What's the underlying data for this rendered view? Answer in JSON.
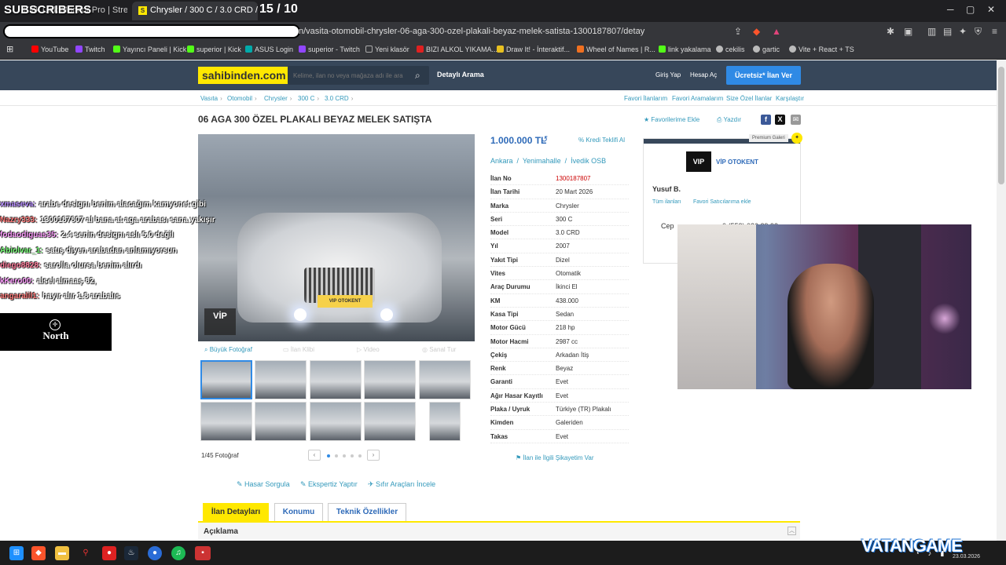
{
  "browser": {
    "tabs": [
      {
        "label": "Kick Link Monitor Pro | Stream Deck"
      },
      {
        "label": "Chrysler / 300 C / 3.0 CRD / 06 A..."
      }
    ],
    "new_tab": "+",
    "url": "n/vasita-otomobil-chrysler-06-aga-300-ozel-plakali-beyaz-melek-satista-1300187807/detay",
    "bookmarks": [
      {
        "label": "YouTube",
        "color": "#ff0000"
      },
      {
        "label": "Twitch",
        "color": "#9146ff"
      },
      {
        "label": "Yayıncı Paneli | Kick",
        "color": "#53fc18"
      },
      {
        "label": "superior | Kick",
        "color": "#53fc18"
      },
      {
        "label": "ASUS Login",
        "color": "#0aa"
      },
      {
        "label": "superior - Twitch",
        "color": "#9146ff"
      },
      {
        "label": "Yeni klasör",
        "color": "#888"
      },
      {
        "label": "BIZI ALKOL YIKAMA...",
        "color": "#e02020"
      },
      {
        "label": "Draw It! - İnteraktif...",
        "color": "#e8c020"
      },
      {
        "label": "Wheel of Names | R...",
        "color": "#f07020"
      },
      {
        "label": "link yakalama",
        "color": "#53fc18"
      },
      {
        "label": "cekilis",
        "color": "#bbb"
      },
      {
        "label": "gartic",
        "color": "#bbb"
      },
      {
        "label": "Vite + React + TS",
        "color": "#bbb"
      }
    ]
  },
  "overlay": {
    "subscribers": "SUBSCRIBERS",
    "counter": "15  / 10",
    "chat": [
      {
        "user": "xmaseva:",
        "msg": "arabe designı benim alacağım kamyonet gibi",
        "color": "#b68cff"
      },
      {
        "user": "Nazry333:",
        "msg": "1300187807 al bana at aga arabası sana yakışır",
        "color": "#ff7a7a"
      },
      {
        "user": "fodaodiguas35:",
        "msg": "2.4 senin designı aslı 5.0 değil",
        "color": "#ff9cff"
      },
      {
        "user": "Abiolvar_1:",
        "msg": "satış diyen arabadan anlamıyorsun",
        "color": "#7aff7a"
      },
      {
        "user": "diego8828:",
        "msg": "sarolla olursa benim alırdı",
        "color": "#ff7a9a"
      },
      {
        "user": "kKero00:",
        "msg": "alsel almaaş 82,",
        "color": "#ff9cff"
      },
      {
        "user": "angaralil1:",
        "msg": "hayır alır 1.8 arabalıs",
        "color": "#ff7a7a"
      }
    ],
    "north": "North",
    "watermark": "VATANGAME",
    "clock": "23.03.2026"
  },
  "site": {
    "logo": "sahibinden.com",
    "search_placeholder": "Kelime, ilan no veya mağaza adı ile ara",
    "detayli_arama": "Detaylı Arama",
    "giris": "Giriş Yap",
    "hesap": "Hesap Aç",
    "ilan_ver": "Ücretsiz* İlan Ver",
    "breadcrumbs": [
      "Vasıta",
      "Otomobil",
      "Chrysler",
      "300 C",
      "3.0 CRD"
    ],
    "top_links": [
      "Favori İlanlarım",
      "Favori Aramalarım",
      "Size Özel İlanlar",
      "Karşılaştır"
    ]
  },
  "listing": {
    "title": "06 AGA 300 ÖZEL PLAKALI BEYAZ MELEK SATIŞTA",
    "favori": "Favorilerime Ekle",
    "yazdir": "Yazdır",
    "price": "1.000.000 TL",
    "kredi": "Kredi Teklifi Al",
    "location": [
      "Ankara",
      "Yenimahalle",
      "İvedik OSB"
    ],
    "photo_plate": "VIP OTOKENT",
    "photo_badge": "VİP",
    "photo_tabs": [
      "Büyük Fotoğraf",
      "İlan Klibi",
      "Video",
      "Sanal Tur"
    ],
    "photo_count": "1/45 Fotoğraf",
    "tools": [
      "Hasar Sorgula",
      "Ekspertiz Yaptır",
      "Sıfır Araçları İncele"
    ],
    "sikayet": "İlan ile İlgili Şikayetim Var",
    "details": [
      {
        "k": "İlan No",
        "v": "1300187807",
        "red": true
      },
      {
        "k": "İlan Tarihi",
        "v": "20 Mart 2026"
      },
      {
        "k": "Marka",
        "v": "Chrysler"
      },
      {
        "k": "Seri",
        "v": "300 C"
      },
      {
        "k": "Model",
        "v": "3.0 CRD"
      },
      {
        "k": "Yıl",
        "v": "2007"
      },
      {
        "k": "Yakıt Tipi",
        "v": "Dizel"
      },
      {
        "k": "Vites",
        "v": "Otomatik"
      },
      {
        "k": "Araç Durumu",
        "v": "İkinci El"
      },
      {
        "k": "KM",
        "v": "438.000"
      },
      {
        "k": "Kasa Tipi",
        "v": "Sedan"
      },
      {
        "k": "Motor Gücü",
        "v": "218 hp"
      },
      {
        "k": "Motor Hacmi",
        "v": "2987 cc"
      },
      {
        "k": "Çekiş",
        "v": "Arkadan İtiş"
      },
      {
        "k": "Renk",
        "v": "Beyaz"
      },
      {
        "k": "Garanti",
        "v": "Evet"
      },
      {
        "k": "Ağır Hasar Kayıtlı",
        "v": "Evet"
      },
      {
        "k": "Plaka / Uyruk",
        "v": "Türkiye (TR) Plakalı"
      },
      {
        "k": "Kimden",
        "v": "Galeriden"
      },
      {
        "k": "Takas",
        "v": "Evet"
      }
    ],
    "bottom_tabs": [
      "İlan Detayları",
      "Konumu",
      "Teknik Özellikler"
    ],
    "aciklama": "Açıklama"
  },
  "seller": {
    "premium": "Premium Galeri",
    "logo": "VIP",
    "name": "VİP OTOKENT",
    "person": "Yusuf B.",
    "tum_ilanlar": "Tüm ilanları",
    "favori_satici": "Favori Satıcılarıma ekle",
    "cep_label": "Cep",
    "cep": "0 (553) 026 29 93"
  },
  "colors": {
    "accent": "#ffe800",
    "header": "#37475a",
    "link": "#3399bb",
    "button": "#2f8ae5"
  }
}
